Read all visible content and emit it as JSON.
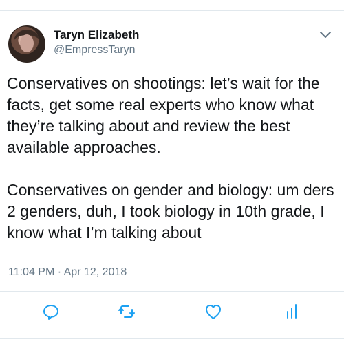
{
  "tweet": {
    "author_name": "Taryn Elizabeth",
    "handle": "@EmpressTaryn",
    "text": "Conservatives on shootings: let’s wait for the facts, get some real experts who know what they’re talking about and review the best available approaches.\n\nConservatives on gender and biology: um ders 2 genders, duh, I took biology in 10th grade, I know what I’m talking about",
    "timestamp": "11:04 PM · Apr 12, 2018"
  },
  "icons": {
    "more": "chevron-down-icon",
    "reply": "reply-icon",
    "retweet": "retweet-icon",
    "like": "heart-icon",
    "stats": "analytics-icon"
  },
  "colors": {
    "text": "#14171a",
    "secondary": "#657786",
    "icon": "#1da1f2",
    "divider": "#e1e8ed"
  }
}
